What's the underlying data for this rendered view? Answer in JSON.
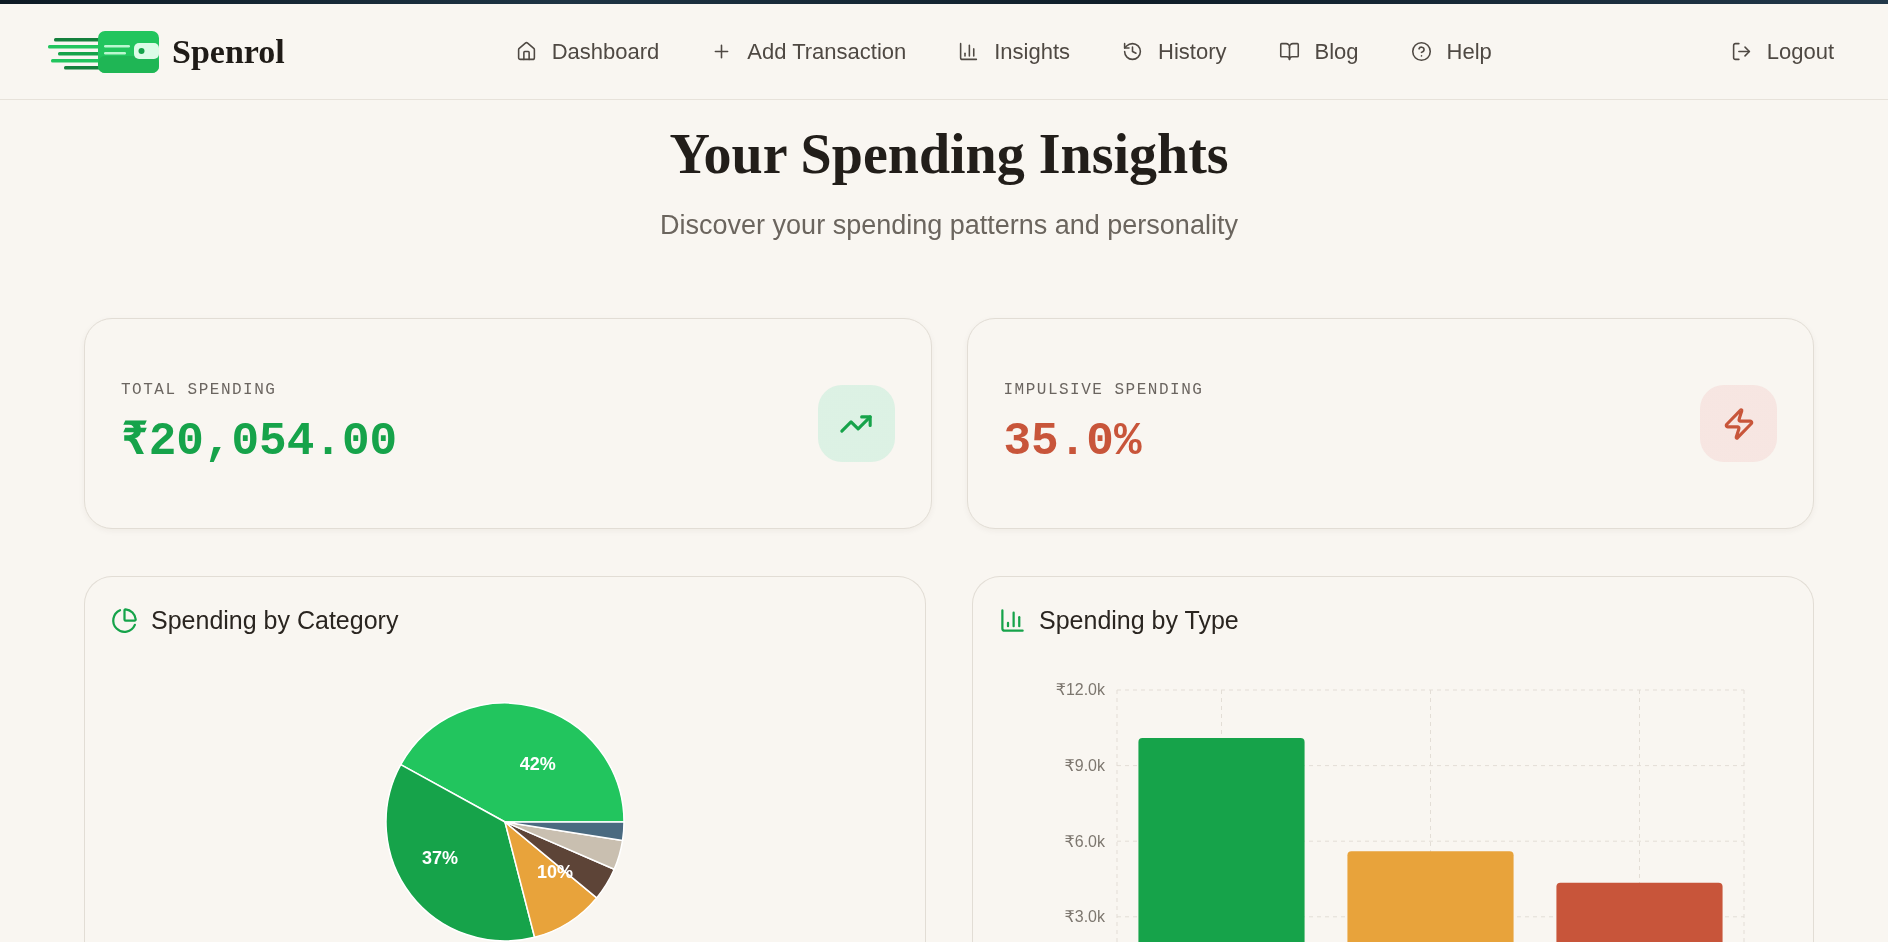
{
  "header": {
    "brand": "Spenrol",
    "nav": [
      {
        "label": "Dashboard"
      },
      {
        "label": "Add Transaction"
      },
      {
        "label": "Insights"
      },
      {
        "label": "History"
      },
      {
        "label": "Blog"
      },
      {
        "label": "Help"
      }
    ],
    "logout": {
      "label": "Logout"
    }
  },
  "intro": {
    "title": "Your Spending Insights",
    "subtitle": "Discover your spending patterns and personality"
  },
  "stats": [
    {
      "label": "TOTAL SPENDING",
      "value": "₹20,054.00",
      "color": "#16a34a"
    },
    {
      "label": "IMPULSIVE SPENDING",
      "value": "35.0%",
      "color": "#c8553a"
    }
  ],
  "charts": [
    {
      "title": "Spending by Category",
      "chart_data": {
        "type": "pie",
        "values": [
          42,
          37,
          10,
          4.5,
          4,
          2.5
        ],
        "colors": [
          "#22c55e",
          "#16a34a",
          "#e8a33b",
          "#5d4437",
          "#c9bfb0",
          "#4a6a80"
        ],
        "value_labels": [
          "42%",
          "37%",
          "10%",
          null,
          null,
          null
        ]
      }
    },
    {
      "title": "Spending by Type",
      "chart_data": {
        "type": "bar",
        "values": [
          10100,
          5600,
          4350
        ],
        "colors": [
          "#16a34a",
          "#e8a33b",
          "#c8553a"
        ],
        "ylim": [
          0,
          12000
        ],
        "yticks": [
          {
            "value": 3000,
            "label": "₹3.0k"
          },
          {
            "value": 6000,
            "label": "₹6.0k"
          },
          {
            "value": 9000,
            "label": "₹9.0k"
          },
          {
            "value": 12000,
            "label": "₹12.0k"
          }
        ],
        "grid": true
      }
    }
  ]
}
